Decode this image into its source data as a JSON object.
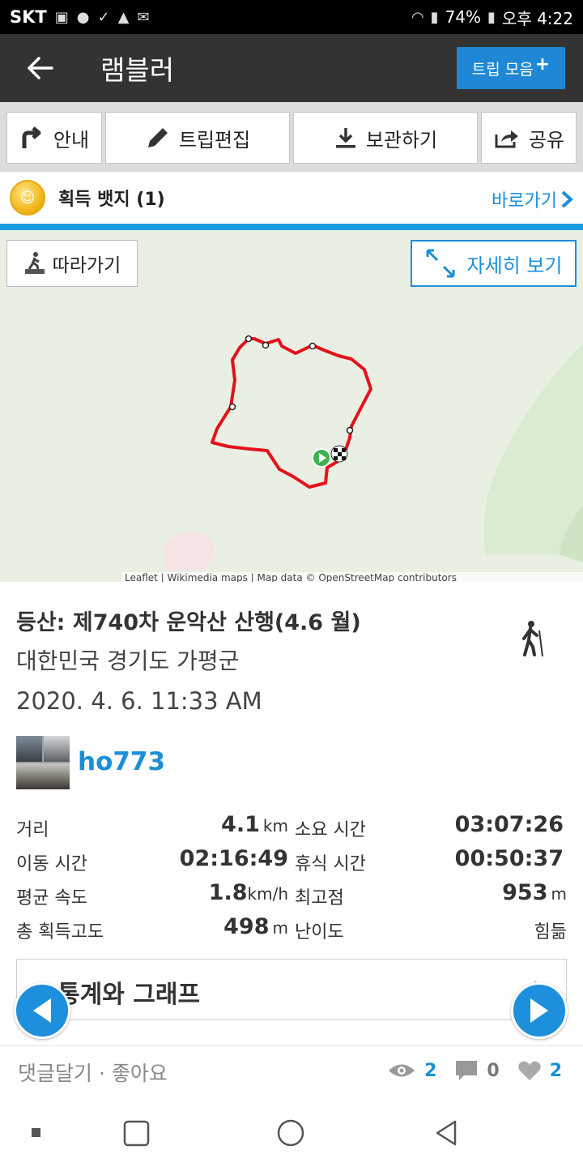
{
  "status": {
    "carrier": "SKT",
    "battery": "74%",
    "time": "오후 4:22"
  },
  "appbar": {
    "title": "램블러",
    "trip_collect": "트립 모음"
  },
  "toolbar": {
    "guide": "안내",
    "edit": "트립편집",
    "save": "보관하기",
    "share": "공유"
  },
  "badge": {
    "label": "획득 뱃지 (1)",
    "go": "바로가기"
  },
  "map": {
    "follow": "따라가기",
    "detail": "자세히 보기",
    "attribution": "Leaflet | Wikimedia maps | Map data © OpenStreetMap contributors"
  },
  "trip": {
    "title": "등산: 제740차 운악산 산행(4.6 월)",
    "location": "대한민국 경기도 가평군",
    "date": "2020. 4. 6. 11:33 AM",
    "user": "ho773"
  },
  "stats": {
    "distance_label": "거리",
    "distance_value": "4.1",
    "distance_unit": "km",
    "duration_label": "소요 시간",
    "duration_value": "03:07:26",
    "moving_label": "이동 시간",
    "moving_value": "02:16:49",
    "rest_label": "휴식 시간",
    "rest_value": "00:50:37",
    "speed_label": "평균 속도",
    "speed_value": "1.8",
    "speed_unit": "km/h",
    "peak_label": "최고점",
    "peak_value": "953",
    "peak_unit": "m",
    "gain_label": "총 획득고도",
    "gain_value": "498",
    "gain_unit": "m",
    "difficulty_label": "난이도",
    "difficulty_value": "힘듦"
  },
  "graph": {
    "label": "통계와 그래프"
  },
  "footer": {
    "actions": "댓글달기 · 좋아요",
    "views": "2",
    "comments": "0",
    "likes": "2"
  },
  "colors": {
    "accent": "#1a8fd8",
    "appbar": "#333333",
    "route": "#e3121b"
  },
  "icons": [
    "back-arrow-icon",
    "plus-icon",
    "turn-arrow-icon",
    "pencil-icon",
    "download-icon",
    "share-icon",
    "medal-icon",
    "chevron-right-icon",
    "walker-icon",
    "expand-icon",
    "hiker-icon",
    "prev-arrow-icon",
    "next-arrow-icon",
    "eye-icon",
    "comment-icon",
    "heart-icon"
  ]
}
